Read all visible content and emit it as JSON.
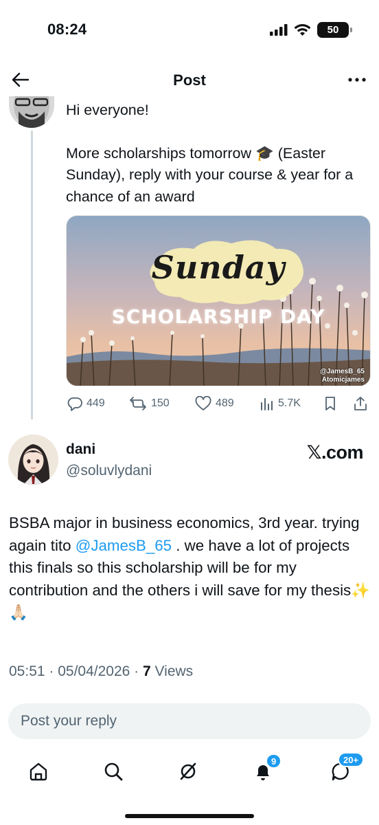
{
  "status_bar": {
    "time": "08:24",
    "battery": "50",
    "battery_level": 0.5,
    "icons": [
      "cellular-signal-icon",
      "wifi-icon",
      "battery-icon"
    ]
  },
  "header": {
    "title": "Post",
    "back_icon": "arrow-left-icon",
    "more_icon": "more-horizontal-icon"
  },
  "original_post": {
    "line1": "Hi everyone!",
    "line2": "More scholarships tomorrow 🎓 (Easter Sunday), reply with your course & year for a chance of an award",
    "media": {
      "script_text": "Sunday",
      "caption": "SCHOLARSHIP DAY",
      "handle_twitter": "@JamesB_65",
      "handle_youtube": "Atomicjames"
    },
    "stats": {
      "replies": "449",
      "reposts": "150",
      "likes": "489",
      "views": "5.7K"
    }
  },
  "reply": {
    "name": "dani",
    "handle": "@soluvlydani",
    "source": "𝕏.com",
    "text_before": "BSBA major in business economics, 3rd year. trying again tito ",
    "mention": "@JamesB_65",
    "text_after": " . we have a lot of projects this finals so this scholarship will be for my contribution and the others i will save for my thesis✨🙏🏻",
    "time": "05:51",
    "date": "05/04/2026",
    "views_count": "7",
    "views_label": "Views"
  },
  "composer": {
    "placeholder": "Post your reply"
  },
  "bottom_nav": {
    "notifications_badge": "9",
    "messages_badge": "20+"
  },
  "colors": {
    "accent": "#1d9bf0",
    "text_primary": "#0f1419",
    "text_secondary": "#536471",
    "input_bg": "#eff3f4"
  }
}
